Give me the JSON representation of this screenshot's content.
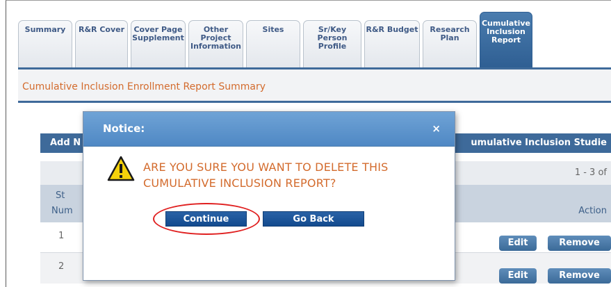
{
  "tabs": [
    {
      "label": "Summary",
      "active": false
    },
    {
      "label": "R&R Cover",
      "active": false
    },
    {
      "label": "Cover Page Supplement",
      "active": false
    },
    {
      "label": "Other Project Information",
      "active": false
    },
    {
      "label": "Sites",
      "active": false
    },
    {
      "label": "Sr/Key Person Profile",
      "active": false
    },
    {
      "label": "R&R Budget",
      "active": false
    },
    {
      "label": "Research Plan",
      "active": false
    },
    {
      "label": "Cumulative Inclusion Report",
      "active": true
    }
  ],
  "subheader": {
    "title": "Cumulative Inclusion Enrollment Report Summary"
  },
  "list": {
    "add_button_label": "Add N",
    "title": "umulative Inclusion Studie",
    "pager": "1 - 3 of",
    "column_study_top": "St",
    "column_study_bottom": "Num",
    "column_action": "Action",
    "rows": [
      {
        "number": "1",
        "edit_label": "Edit",
        "remove_label": "Remove"
      },
      {
        "number": "2",
        "edit_label": "Edit",
        "remove_label": "Remove"
      }
    ]
  },
  "modal": {
    "title": "Notice:",
    "close_glyph": "×",
    "message": "ARE YOU SURE YOU WANT TO DELETE THIS CUMULATIVE INCLUSION REPORT?",
    "continue_label": "Continue",
    "go_back_label": "Go Back",
    "icon": "warning-icon"
  },
  "colors": {
    "accent": "#3e6a9a",
    "warning_text": "#d36b2d",
    "highlight": "#e02020"
  }
}
